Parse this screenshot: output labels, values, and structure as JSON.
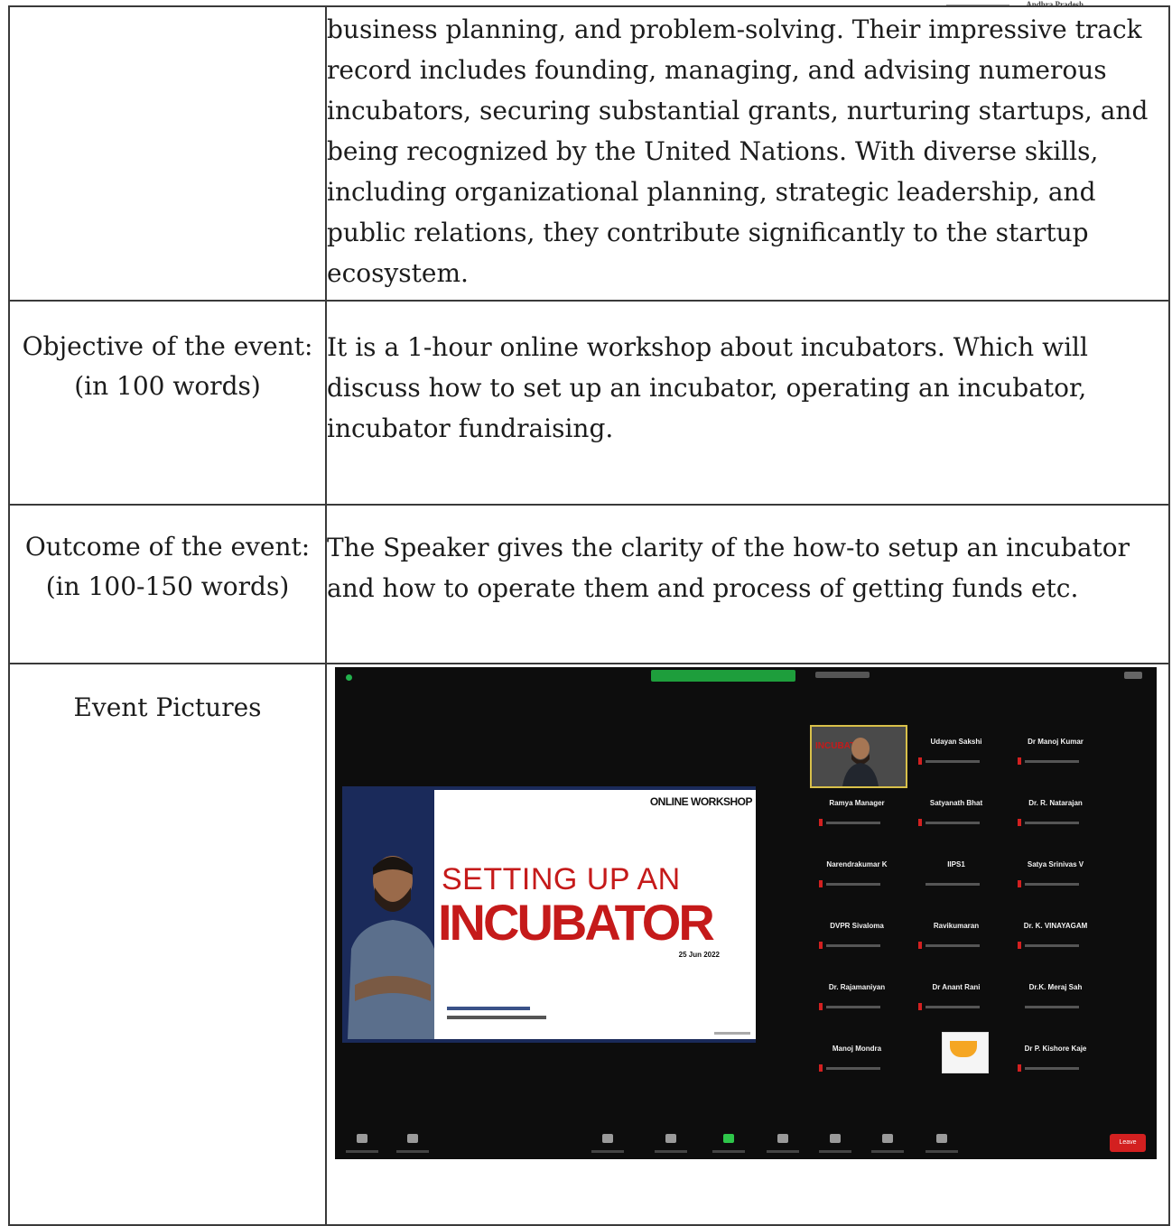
{
  "header": {
    "state": "Andhra Pradesh"
  },
  "rows": [
    {
      "label": "",
      "value": "business planning, and problem-solving. Their impressive track record includes founding, managing, and advising numerous incubators, securing substantial grants, nurturing startups, and being recognized by the United Nations. With diverse skills, including organizational planning, strategic leadership, and public relations, they contribute significantly to the startup ecosystem."
    },
    {
      "label_line1": "Objective of the event:",
      "label_line2": "(in 100 words)",
      "value": "It is a 1-hour online workshop about incubators. Which will discuss how to set up an incubator, operating an incubator, incubator fundraising."
    },
    {
      "label_line1": "Outcome of the event:",
      "label_line2": "(in 100-150 words)",
      "value": "The Speaker gives the clarity of the how-to setup an incubator and how to operate them and process of getting funds etc."
    },
    {
      "label_line1": "Event Pictures"
    }
  ],
  "event_photo": {
    "slide": {
      "tag": "ONLINE WORKSHOP",
      "line1": "SETTING UP AN",
      "line2": "INCUBATOR",
      "date": "25 Jun 2022"
    },
    "speaker_tile_text": "INCUBATOR",
    "participants": [
      "Udayan Sakshi",
      "Dr Manoj Kumar",
      "Ramya Manager",
      "Satyanath Bhat",
      "Dr. R. Natarajan",
      "Narendrakumar K",
      "IIPS1",
      "Satya Srinivas V",
      "DVPR Sivaloma",
      "Ravikumaran",
      "Dr. K. VINAYAGAM",
      "Dr. Rajamaniyan",
      "Dr Anant Rani",
      "Dr.K. Meraj Sah",
      "Manoj Mondra",
      "Dr P. Kishore Kaje"
    ],
    "leave_label": "Leave"
  }
}
